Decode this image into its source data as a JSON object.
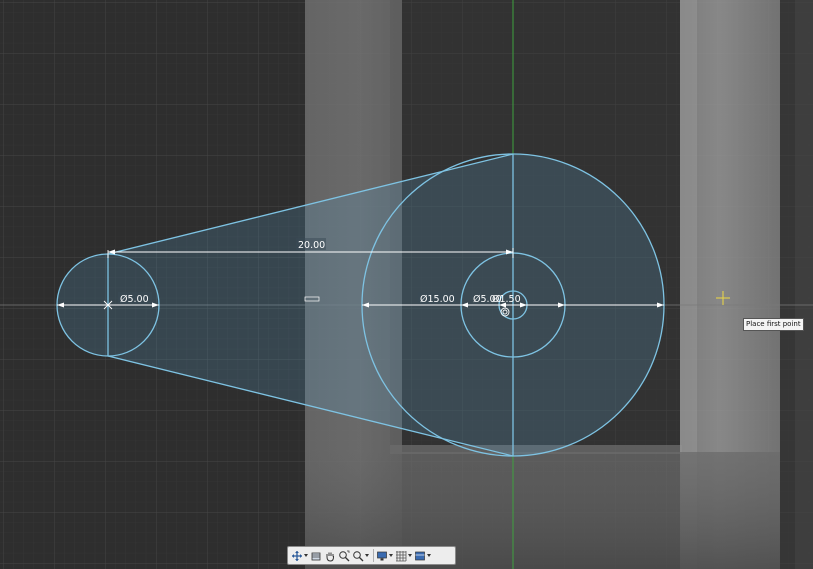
{
  "sketch": {
    "dimensions": {
      "center_distance": "20.00",
      "small_circle_diameter": "Ø5.00",
      "large_circle_diameter": "Ø15.00",
      "mid_circle_diameter": "Ø5.00",
      "inner_circle_diameter": "Ø1.50"
    },
    "tooltip": "Place first point"
  },
  "colors": {
    "canvas_background": "#2e2e2e",
    "sketch_line": "#7ec3e3",
    "profile_fill": "#5aa0c8",
    "dimension": "#ffffff",
    "axis_green": "#3fa13f",
    "cursor": "#e6d24a"
  },
  "navbar": {
    "icons": [
      "orbit-icon",
      "look-at-icon",
      "pan-icon",
      "zoom-icon",
      "fit-icon",
      "display-settings-icon",
      "grid-settings-icon",
      "viewports-icon"
    ]
  }
}
